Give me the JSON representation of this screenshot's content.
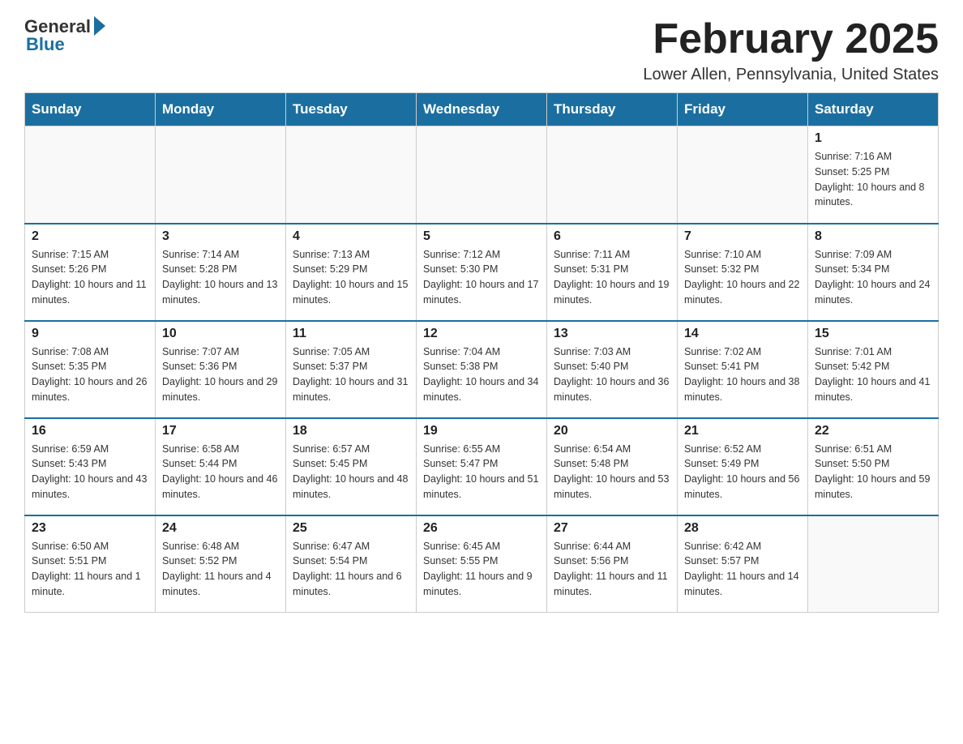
{
  "header": {
    "logo_general": "General",
    "logo_blue": "Blue",
    "title": "February 2025",
    "subtitle": "Lower Allen, Pennsylvania, United States"
  },
  "days_of_week": [
    "Sunday",
    "Monday",
    "Tuesday",
    "Wednesday",
    "Thursday",
    "Friday",
    "Saturday"
  ],
  "weeks": [
    [
      {
        "day": "",
        "info": []
      },
      {
        "day": "",
        "info": []
      },
      {
        "day": "",
        "info": []
      },
      {
        "day": "",
        "info": []
      },
      {
        "day": "",
        "info": []
      },
      {
        "day": "",
        "info": []
      },
      {
        "day": "1",
        "info": [
          "Sunrise: 7:16 AM",
          "Sunset: 5:25 PM",
          "Daylight: 10 hours and 8 minutes."
        ]
      }
    ],
    [
      {
        "day": "2",
        "info": [
          "Sunrise: 7:15 AM",
          "Sunset: 5:26 PM",
          "Daylight: 10 hours and 11 minutes."
        ]
      },
      {
        "day": "3",
        "info": [
          "Sunrise: 7:14 AM",
          "Sunset: 5:28 PM",
          "Daylight: 10 hours and 13 minutes."
        ]
      },
      {
        "day": "4",
        "info": [
          "Sunrise: 7:13 AM",
          "Sunset: 5:29 PM",
          "Daylight: 10 hours and 15 minutes."
        ]
      },
      {
        "day": "5",
        "info": [
          "Sunrise: 7:12 AM",
          "Sunset: 5:30 PM",
          "Daylight: 10 hours and 17 minutes."
        ]
      },
      {
        "day": "6",
        "info": [
          "Sunrise: 7:11 AM",
          "Sunset: 5:31 PM",
          "Daylight: 10 hours and 19 minutes."
        ]
      },
      {
        "day": "7",
        "info": [
          "Sunrise: 7:10 AM",
          "Sunset: 5:32 PM",
          "Daylight: 10 hours and 22 minutes."
        ]
      },
      {
        "day": "8",
        "info": [
          "Sunrise: 7:09 AM",
          "Sunset: 5:34 PM",
          "Daylight: 10 hours and 24 minutes."
        ]
      }
    ],
    [
      {
        "day": "9",
        "info": [
          "Sunrise: 7:08 AM",
          "Sunset: 5:35 PM",
          "Daylight: 10 hours and 26 minutes."
        ]
      },
      {
        "day": "10",
        "info": [
          "Sunrise: 7:07 AM",
          "Sunset: 5:36 PM",
          "Daylight: 10 hours and 29 minutes."
        ]
      },
      {
        "day": "11",
        "info": [
          "Sunrise: 7:05 AM",
          "Sunset: 5:37 PM",
          "Daylight: 10 hours and 31 minutes."
        ]
      },
      {
        "day": "12",
        "info": [
          "Sunrise: 7:04 AM",
          "Sunset: 5:38 PM",
          "Daylight: 10 hours and 34 minutes."
        ]
      },
      {
        "day": "13",
        "info": [
          "Sunrise: 7:03 AM",
          "Sunset: 5:40 PM",
          "Daylight: 10 hours and 36 minutes."
        ]
      },
      {
        "day": "14",
        "info": [
          "Sunrise: 7:02 AM",
          "Sunset: 5:41 PM",
          "Daylight: 10 hours and 38 minutes."
        ]
      },
      {
        "day": "15",
        "info": [
          "Sunrise: 7:01 AM",
          "Sunset: 5:42 PM",
          "Daylight: 10 hours and 41 minutes."
        ]
      }
    ],
    [
      {
        "day": "16",
        "info": [
          "Sunrise: 6:59 AM",
          "Sunset: 5:43 PM",
          "Daylight: 10 hours and 43 minutes."
        ]
      },
      {
        "day": "17",
        "info": [
          "Sunrise: 6:58 AM",
          "Sunset: 5:44 PM",
          "Daylight: 10 hours and 46 minutes."
        ]
      },
      {
        "day": "18",
        "info": [
          "Sunrise: 6:57 AM",
          "Sunset: 5:45 PM",
          "Daylight: 10 hours and 48 minutes."
        ]
      },
      {
        "day": "19",
        "info": [
          "Sunrise: 6:55 AM",
          "Sunset: 5:47 PM",
          "Daylight: 10 hours and 51 minutes."
        ]
      },
      {
        "day": "20",
        "info": [
          "Sunrise: 6:54 AM",
          "Sunset: 5:48 PM",
          "Daylight: 10 hours and 53 minutes."
        ]
      },
      {
        "day": "21",
        "info": [
          "Sunrise: 6:52 AM",
          "Sunset: 5:49 PM",
          "Daylight: 10 hours and 56 minutes."
        ]
      },
      {
        "day": "22",
        "info": [
          "Sunrise: 6:51 AM",
          "Sunset: 5:50 PM",
          "Daylight: 10 hours and 59 minutes."
        ]
      }
    ],
    [
      {
        "day": "23",
        "info": [
          "Sunrise: 6:50 AM",
          "Sunset: 5:51 PM",
          "Daylight: 11 hours and 1 minute."
        ]
      },
      {
        "day": "24",
        "info": [
          "Sunrise: 6:48 AM",
          "Sunset: 5:52 PM",
          "Daylight: 11 hours and 4 minutes."
        ]
      },
      {
        "day": "25",
        "info": [
          "Sunrise: 6:47 AM",
          "Sunset: 5:54 PM",
          "Daylight: 11 hours and 6 minutes."
        ]
      },
      {
        "day": "26",
        "info": [
          "Sunrise: 6:45 AM",
          "Sunset: 5:55 PM",
          "Daylight: 11 hours and 9 minutes."
        ]
      },
      {
        "day": "27",
        "info": [
          "Sunrise: 6:44 AM",
          "Sunset: 5:56 PM",
          "Daylight: 11 hours and 11 minutes."
        ]
      },
      {
        "day": "28",
        "info": [
          "Sunrise: 6:42 AM",
          "Sunset: 5:57 PM",
          "Daylight: 11 hours and 14 minutes."
        ]
      },
      {
        "day": "",
        "info": []
      }
    ]
  ]
}
